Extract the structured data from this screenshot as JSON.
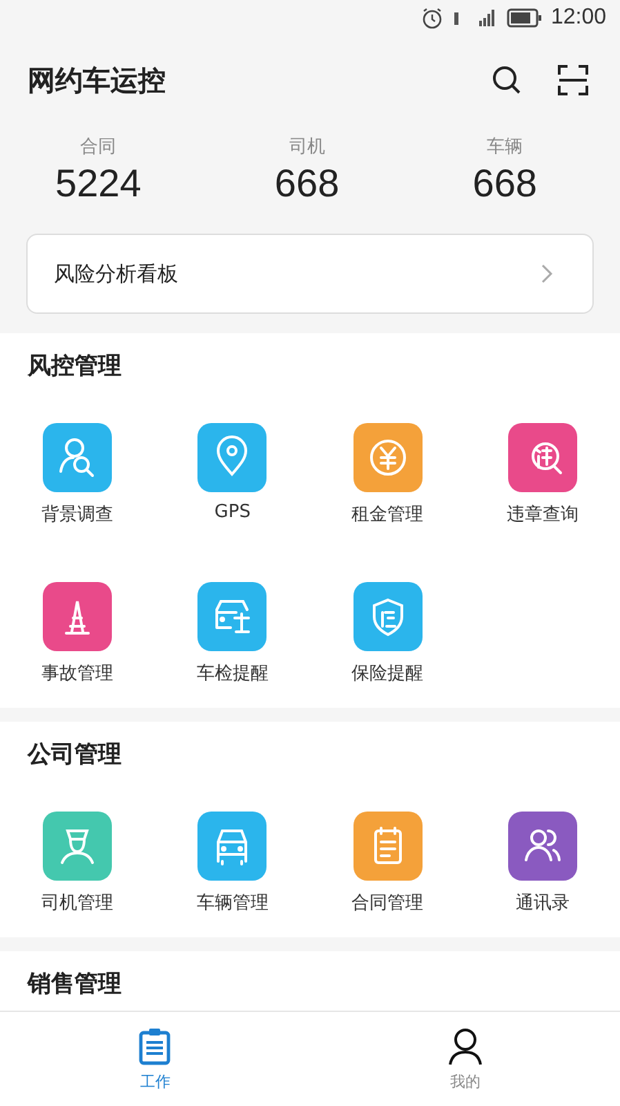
{
  "status_bar": {
    "time": "12:00"
  },
  "header": {
    "title": "网约车运控"
  },
  "stats": [
    {
      "label": "合同",
      "value": "5224"
    },
    {
      "label": "司机",
      "value": "668"
    },
    {
      "label": "车辆",
      "value": "668"
    }
  ],
  "risk_board": {
    "label": "风险分析看板"
  },
  "sections": [
    {
      "title": "风控管理",
      "items": [
        {
          "label": "背景调查",
          "kind": "person-search",
          "color": "#2bb5ec"
        },
        {
          "label": "GPS",
          "kind": "pin",
          "color": "#2bb5ec"
        },
        {
          "label": "租金管理",
          "kind": "yen",
          "color": "#f4a13a"
        },
        {
          "label": "违章查询",
          "kind": "violation",
          "color": "#e94a8a"
        },
        {
          "label": "事故管理",
          "kind": "cone",
          "color": "#e94a8a"
        },
        {
          "label": "车检提醒",
          "kind": "car-check",
          "color": "#2bb5ec"
        },
        {
          "label": "保险提醒",
          "kind": "shield",
          "color": "#2bb5ec"
        }
      ]
    },
    {
      "title": "公司管理",
      "items": [
        {
          "label": "司机管理",
          "kind": "driver",
          "color": "#44c8ae"
        },
        {
          "label": "车辆管理",
          "kind": "car",
          "color": "#2bb5ec"
        },
        {
          "label": "合同管理",
          "kind": "doc",
          "color": "#f4a13a"
        },
        {
          "label": "通讯录",
          "kind": "people",
          "color": "#8a5ac0"
        }
      ]
    },
    {
      "title": "销售管理"
    }
  ],
  "tabs": [
    {
      "label": "工作",
      "kind": "work",
      "selected": true
    },
    {
      "label": "我的",
      "kind": "me",
      "selected": false
    }
  ]
}
